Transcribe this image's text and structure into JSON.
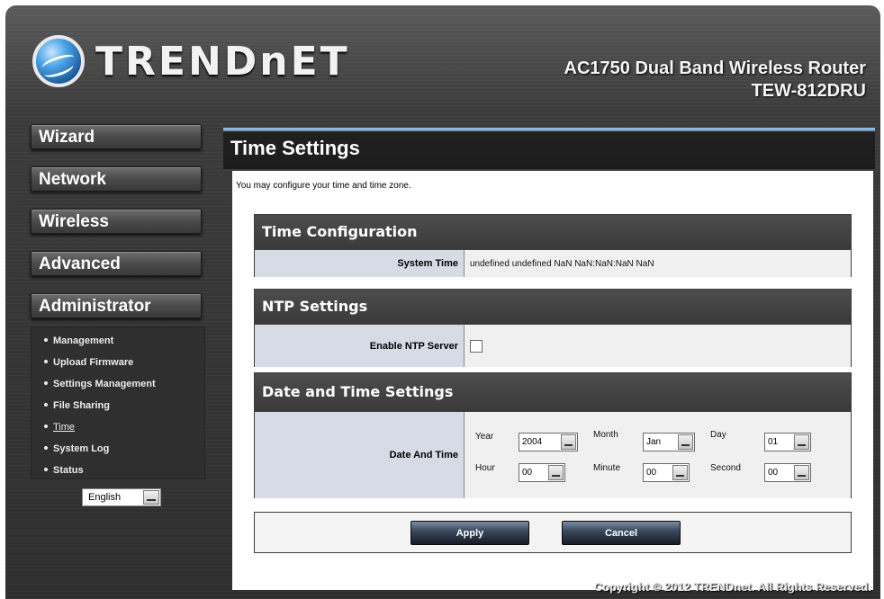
{
  "brand": {
    "logo_text": "TRENDnET"
  },
  "header": {
    "product_line1": "AC1750 Dual Band Wireless Router",
    "product_line2": "TEW-812DRU"
  },
  "sidebar": {
    "buttons": [
      "Wizard",
      "Network",
      "Wireless",
      "Advanced",
      "Administrator"
    ],
    "admin_items": [
      "Management",
      "Upload Firmware",
      "Settings Management",
      "File Sharing",
      "Time",
      "System Log",
      "Status"
    ],
    "active_item": "Time",
    "language": "English"
  },
  "main": {
    "title": "Time Settings",
    "intro": "You may configure your time and time zone.",
    "time_config": {
      "heading": "Time Configuration",
      "system_time_label": "System Time",
      "system_time_value": "undefined undefined NaN NaN:NaN:NaN NaN"
    },
    "ntp": {
      "heading": "NTP Settings",
      "enable_label": "Enable NTP Server",
      "enabled": false
    },
    "date_time": {
      "heading": "Date and Time Settings",
      "label": "Date And Time",
      "year_label": "Year",
      "year_value": "2004",
      "month_label": "Month",
      "month_value": "Jan",
      "day_label": "Day",
      "day_value": "01",
      "hour_label": "Hour",
      "hour_value": "00",
      "minute_label": "Minute",
      "minute_value": "00",
      "second_label": "Second",
      "second_value": "00"
    },
    "apply_label": "Apply",
    "cancel_label": "Cancel"
  },
  "footer": {
    "copyright": "Copyright © 2012 TRENDnet. All Rights Reserved."
  }
}
